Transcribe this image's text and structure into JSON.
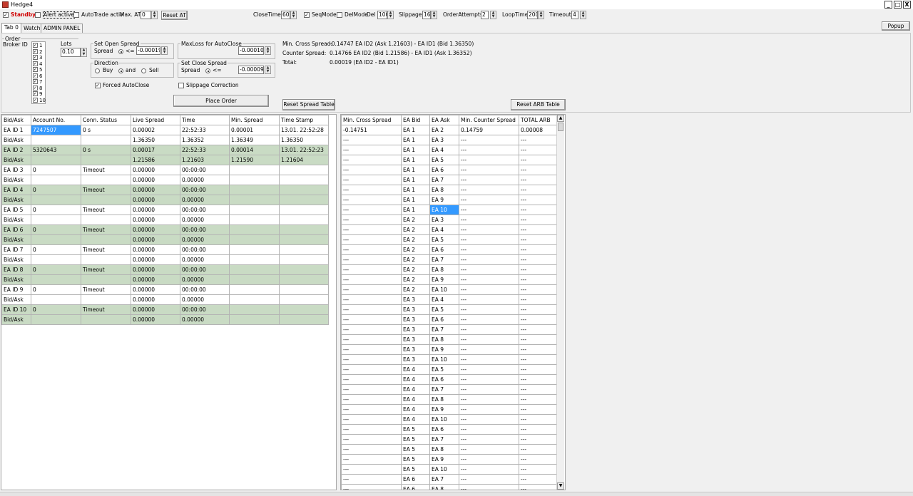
{
  "window": {
    "title": "Hedge4",
    "minimize": "_",
    "maximize": "□",
    "close": "X"
  },
  "toolbar": {
    "standby_label": "Standby",
    "alert_label": "Alert active",
    "autotrade_label": "AutoTrade activ",
    "max_at_label": "Max. AT",
    "max_at_value": "0",
    "reset_at_label": "Reset AT",
    "closetime_label": "CloseTime",
    "closetime_value": "60",
    "seqmode_label": "SeqMode",
    "delmode_label": "DelMode",
    "del_label": "Del",
    "del_value": "100",
    "slippage_label": "Slippage",
    "slippage_value": "16",
    "orderattempts_label": "OrderAttempts",
    "orderattempts_value": "2",
    "looptime_label": "LoopTime",
    "looptime_value": "200",
    "timeout_label": "Timeout",
    "timeout_value": "4"
  },
  "tabs": [
    "Tab 0",
    "Watch",
    "ADMIN PANEL"
  ],
  "popup_label": "Popup",
  "order": {
    "group_title": "Order",
    "broker_label": "Broker ID",
    "brokers": [
      "1",
      "2",
      "3",
      "4",
      "5",
      "6",
      "7",
      "8",
      "9",
      "10"
    ],
    "lots_label": "Lots",
    "lots_value": "0.10",
    "open_spread_title": "Set Open Spread",
    "spread_label": "Spread",
    "open_op": "<=",
    "open_value": "-0.00019",
    "direction_title": "Direction",
    "buy_label": "Buy",
    "and_label": "and",
    "sell_label": "Sell",
    "maxloss_title": "MaxLoss for AutoClose",
    "maxloss_value": "-0.00010",
    "close_spread_title": "Set Close Spread",
    "close_op": "<=",
    "close_value": "-0.00009",
    "forced_label": "Forced AutoClose",
    "slippage_corr_label": "Slippage Correction",
    "place_order_label": "Place Order"
  },
  "info": {
    "cross_label": "Min. Cross Spread:",
    "cross_value": "-0.14747 EA ID2 (Ask 1.21603) - EA ID1 (Bid 1.36350)",
    "counter_label": "Counter Spread:",
    "counter_value": "0.14766 EA ID2 (Bid 1.21586) - EA ID1 (Ask 1.36352)",
    "total_label": "Total:",
    "total_value": "0.00019 (EA ID2 - EA ID1)"
  },
  "reset_spread_label": "Reset Spread Table",
  "reset_arb_label": "Reset ARB Table",
  "left_table": {
    "headers": [
      "Bid/Ask",
      "Account No.",
      "Conn. Status",
      "Live Spread",
      "Time",
      "Min. Spread",
      "Time Stamp"
    ],
    "rows": [
      [
        "EA ID 1",
        "7247507",
        "0 s",
        "0.00002",
        "22:52:33",
        "0.00001",
        "13.01. 22:52:28"
      ],
      [
        "Bid/Ask",
        "",
        "",
        "1.36350",
        "1.36352",
        "1.36349",
        "1.36350"
      ],
      [
        "EA ID 2",
        "5320643",
        "0 s",
        "0.00017",
        "22:52:33",
        "0.00014",
        "13.01. 22:52:23"
      ],
      [
        "Bid/Ask",
        "",
        "",
        "1.21586",
        "1.21603",
        "1.21590",
        "1.21604"
      ],
      [
        "EA ID 3",
        "0",
        "Timeout",
        "0.00000",
        "00:00:00",
        "",
        ""
      ],
      [
        "Bid/Ask",
        "",
        "",
        "0.00000",
        "0.00000",
        "",
        ""
      ],
      [
        "EA ID 4",
        "0",
        "Timeout",
        "0.00000",
        "00:00:00",
        "",
        ""
      ],
      [
        "Bid/Ask",
        "",
        "",
        "0.00000",
        "0.00000",
        "",
        ""
      ],
      [
        "EA ID 5",
        "0",
        "Timeout",
        "0.00000",
        "00:00:00",
        "",
        ""
      ],
      [
        "Bid/Ask",
        "",
        "",
        "0.00000",
        "0.00000",
        "",
        ""
      ],
      [
        "EA ID 6",
        "0",
        "Timeout",
        "0.00000",
        "00:00:00",
        "",
        ""
      ],
      [
        "Bid/Ask",
        "",
        "",
        "0.00000",
        "0.00000",
        "",
        ""
      ],
      [
        "EA ID 7",
        "0",
        "Timeout",
        "0.00000",
        "00:00:00",
        "",
        ""
      ],
      [
        "Bid/Ask",
        "",
        "",
        "0.00000",
        "0.00000",
        "",
        ""
      ],
      [
        "EA ID 8",
        "0",
        "Timeout",
        "0.00000",
        "00:00:00",
        "",
        ""
      ],
      [
        "Bid/Ask",
        "",
        "",
        "0.00000",
        "0.00000",
        "",
        ""
      ],
      [
        "EA ID 9",
        "0",
        "Timeout",
        "0.00000",
        "00:00:00",
        "",
        ""
      ],
      [
        "Bid/Ask",
        "",
        "",
        "0.00000",
        "0.00000",
        "",
        ""
      ],
      [
        "EA ID 10",
        "0",
        "Timeout",
        "0.00000",
        "00:00:00",
        "",
        ""
      ],
      [
        "Bid/Ask",
        "",
        "",
        "0.00000",
        "0.00000",
        "",
        ""
      ]
    ]
  },
  "right_table": {
    "headers": [
      "Min. Cross Spread",
      "EA Bid",
      "EA Ask",
      "Min. Counter Spread",
      "TOTAL ARB"
    ],
    "rows": [
      [
        "-0.14751",
        "EA 1",
        "EA 2",
        "0.14759",
        "0.00008"
      ],
      [
        "---",
        "EA 1",
        "EA 3",
        "---",
        "---"
      ],
      [
        "---",
        "EA 1",
        "EA 4",
        "---",
        "---"
      ],
      [
        "---",
        "EA 1",
        "EA 5",
        "---",
        "---"
      ],
      [
        "---",
        "EA 1",
        "EA 6",
        "---",
        "---"
      ],
      [
        "---",
        "EA 1",
        "EA 7",
        "---",
        "---"
      ],
      [
        "---",
        "EA 1",
        "EA 8",
        "---",
        "---"
      ],
      [
        "---",
        "EA 1",
        "EA 9",
        "---",
        "---"
      ],
      [
        "---",
        "EA 1",
        "EA 10",
        "---",
        "---"
      ],
      [
        "---",
        "EA 2",
        "EA 3",
        "---",
        "---"
      ],
      [
        "---",
        "EA 2",
        "EA 4",
        "---",
        "---"
      ],
      [
        "---",
        "EA 2",
        "EA 5",
        "---",
        "---"
      ],
      [
        "---",
        "EA 2",
        "EA 6",
        "---",
        "---"
      ],
      [
        "---",
        "EA 2",
        "EA 7",
        "---",
        "---"
      ],
      [
        "---",
        "EA 2",
        "EA 8",
        "---",
        "---"
      ],
      [
        "---",
        "EA 2",
        "EA 9",
        "---",
        "---"
      ],
      [
        "---",
        "EA 2",
        "EA 10",
        "---",
        "---"
      ],
      [
        "---",
        "EA 3",
        "EA 4",
        "---",
        "---"
      ],
      [
        "---",
        "EA 3",
        "EA 5",
        "---",
        "---"
      ],
      [
        "---",
        "EA 3",
        "EA 6",
        "---",
        "---"
      ],
      [
        "---",
        "EA 3",
        "EA 7",
        "---",
        "---"
      ],
      [
        "---",
        "EA 3",
        "EA 8",
        "---",
        "---"
      ],
      [
        "---",
        "EA 3",
        "EA 9",
        "---",
        "---"
      ],
      [
        "---",
        "EA 3",
        "EA 10",
        "---",
        "---"
      ],
      [
        "---",
        "EA 4",
        "EA 5",
        "---",
        "---"
      ],
      [
        "---",
        "EA 4",
        "EA 6",
        "---",
        "---"
      ],
      [
        "---",
        "EA 4",
        "EA 7",
        "---",
        "---"
      ],
      [
        "---",
        "EA 4",
        "EA 8",
        "---",
        "---"
      ],
      [
        "---",
        "EA 4",
        "EA 9",
        "---",
        "---"
      ],
      [
        "---",
        "EA 4",
        "EA 10",
        "---",
        "---"
      ],
      [
        "---",
        "EA 5",
        "EA 6",
        "---",
        "---"
      ],
      [
        "---",
        "EA 5",
        "EA 7",
        "---",
        "---"
      ],
      [
        "---",
        "EA 5",
        "EA 8",
        "---",
        "---"
      ],
      [
        "---",
        "EA 5",
        "EA 9",
        "---",
        "---"
      ],
      [
        "---",
        "EA 5",
        "EA 10",
        "---",
        "---"
      ],
      [
        "---",
        "EA 6",
        "EA 7",
        "---",
        "---"
      ],
      [
        "---",
        "EA 6",
        "EA 8",
        "---",
        "---"
      ]
    ]
  },
  "colors": {
    "row_green": "#c9dbc4",
    "selection": "#3399ff",
    "standby_red": "#d00000"
  }
}
